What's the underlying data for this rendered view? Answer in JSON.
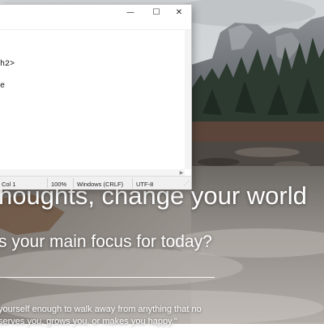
{
  "dashboard": {
    "headline": "houghts, change your world",
    "focus_question": "s your main focus for today?",
    "quote_line1": "yourself enough to walk away from anything that no",
    "quote_line2": "serves you, grows you, or makes you happy.\""
  },
  "notepad": {
    "title_buttons": {
      "minimize": "—",
      "maximize": "☐",
      "close": "✕"
    },
    "lines": [
      "h2>",
      "e"
    ],
    "status": {
      "position": "Col 1",
      "zoom": "100%",
      "line_endings": "Windows (CRLF)",
      "encoding": "UTF-8"
    }
  },
  "colors": {
    "window_bg": "#ffffff",
    "statusbar_bg": "#f0f0f0",
    "overlay_text": "#ffffff"
  }
}
